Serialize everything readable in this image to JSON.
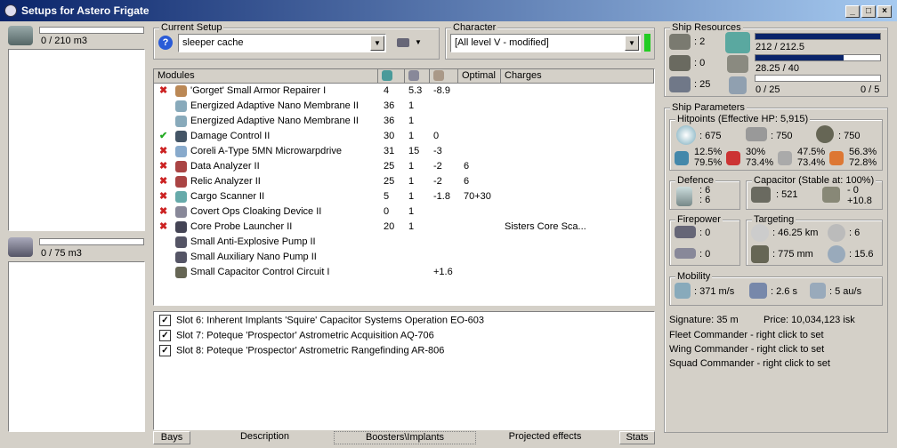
{
  "window": {
    "title": "Setups for Astero Frigate"
  },
  "cargo": {
    "bay1_label": "0 / 210 m3",
    "bay2_label": "0 / 75 m3"
  },
  "current_setup": {
    "group_label": "Current Setup",
    "value": "sleeper cache"
  },
  "character": {
    "group_label": "Character",
    "value": "[All level V - modified]",
    "status_color": "#22cc22"
  },
  "modules": {
    "headers": [
      "Modules",
      "",
      "",
      "",
      "Optimal",
      "Charges"
    ],
    "rows": [
      {
        "status": "off",
        "name": "'Gorget' Small Armor Repairer I",
        "cpu": "4",
        "pg": "5.3",
        "cap": "-8.9",
        "optimal": "",
        "charges": ""
      },
      {
        "status": "",
        "name": "Energized Adaptive Nano Membrane II",
        "cpu": "36",
        "pg": "1",
        "cap": "",
        "optimal": "",
        "charges": ""
      },
      {
        "status": "",
        "name": "Energized Adaptive Nano Membrane II",
        "cpu": "36",
        "pg": "1",
        "cap": "",
        "optimal": "",
        "charges": ""
      },
      {
        "status": "on",
        "name": "Damage Control II",
        "cpu": "30",
        "pg": "1",
        "cap": "0",
        "optimal": "",
        "charges": ""
      },
      {
        "status": "off",
        "name": "Coreli A-Type 5MN Microwarpdrive",
        "cpu": "31",
        "pg": "15",
        "cap": "-3",
        "optimal": "",
        "charges": ""
      },
      {
        "status": "off",
        "name": "Data Analyzer II",
        "cpu": "25",
        "pg": "1",
        "cap": "-2",
        "optimal": "6",
        "charges": ""
      },
      {
        "status": "off",
        "name": "Relic Analyzer II",
        "cpu": "25",
        "pg": "1",
        "cap": "-2",
        "optimal": "6",
        "charges": ""
      },
      {
        "status": "off",
        "name": "Cargo Scanner II",
        "cpu": "5",
        "pg": "1",
        "cap": "-1.8",
        "optimal": "70+30",
        "charges": ""
      },
      {
        "status": "off",
        "name": "Covert Ops Cloaking Device II",
        "cpu": "0",
        "pg": "1",
        "cap": "",
        "optimal": "",
        "charges": ""
      },
      {
        "status": "off",
        "name": "Core Probe Launcher II",
        "cpu": "20",
        "pg": "1",
        "cap": "",
        "optimal": "",
        "charges": "Sisters Core Sca..."
      },
      {
        "status": "",
        "name": "Small Anti-Explosive Pump II",
        "cpu": "",
        "pg": "",
        "cap": "",
        "optimal": "",
        "charges": ""
      },
      {
        "status": "",
        "name": "Small Auxiliary Nano Pump II",
        "cpu": "",
        "pg": "",
        "cap": "",
        "optimal": "",
        "charges": ""
      },
      {
        "status": "",
        "name": "Small Capacitor Control Circuit I",
        "cpu": "",
        "pg": "",
        "cap": "+1.6",
        "optimal": "",
        "charges": ""
      }
    ]
  },
  "implants": [
    "Slot 6: Inherent Implants 'Squire' Capacitor Systems Operation EO-603",
    "Slot 7: Poteque 'Prospector' Astrometric Acquisition AQ-706",
    "Slot 8: Poteque 'Prospector' Astrometric Rangefinding AR-806"
  ],
  "tabs": [
    "Bays",
    "Description",
    "Boosters\\Implants",
    "Projected effects",
    "Stats"
  ],
  "resources": {
    "group_label": "Ship Resources",
    "hardpoints": [
      ": 2",
      ": 0",
      ": 25"
    ],
    "cpu_label": "212 / 212.5",
    "cpu_fill": 0.998,
    "pg_label": "28.25 / 40",
    "pg_fill": 0.706,
    "drone_label": "0 / 25",
    "drone_fill": 0,
    "drone_count": "0 / 5"
  },
  "params": {
    "group_label": "Ship Parameters",
    "hitpoints_label": "Hitpoints (Effective HP: 5,915)",
    "shield_hp": ": 675",
    "armor_hp": ": 750",
    "structure_hp": ": 750",
    "resists": [
      [
        "12.5%",
        "79.5%"
      ],
      [
        "30%",
        "73.4%"
      ],
      [
        "47.5%",
        "73.4%"
      ],
      [
        "56.3%",
        "72.8%"
      ]
    ],
    "defence_label": "Defence",
    "defence": [
      ": 6",
      ": 6"
    ],
    "capacitor_label": "Capacitor (Stable at: 100%)",
    "cap_amount": ": 521",
    "cap_delta": [
      "- 0",
      "+10.8"
    ],
    "firepower_label": "Firepower",
    "firepower": [
      ": 0",
      ": 0"
    ],
    "targeting_label": "Targeting",
    "target_range": ": 46.25 km",
    "max_targets": ": 6",
    "sig_res": ": 775 mm",
    "scan_strength": ": 15.6",
    "mobility_label": "Mobility",
    "speed": ": 371 m/s",
    "align": ": 2.6 s",
    "warp": ": 5 au/s"
  },
  "info": {
    "signature": "Signature: 35 m",
    "price": "Price: 10,034,123 isk",
    "fleet": "Fleet Commander - right click to set",
    "wing": "Wing Commander - right click to set",
    "squad": "Squad Commander - right click to set"
  }
}
